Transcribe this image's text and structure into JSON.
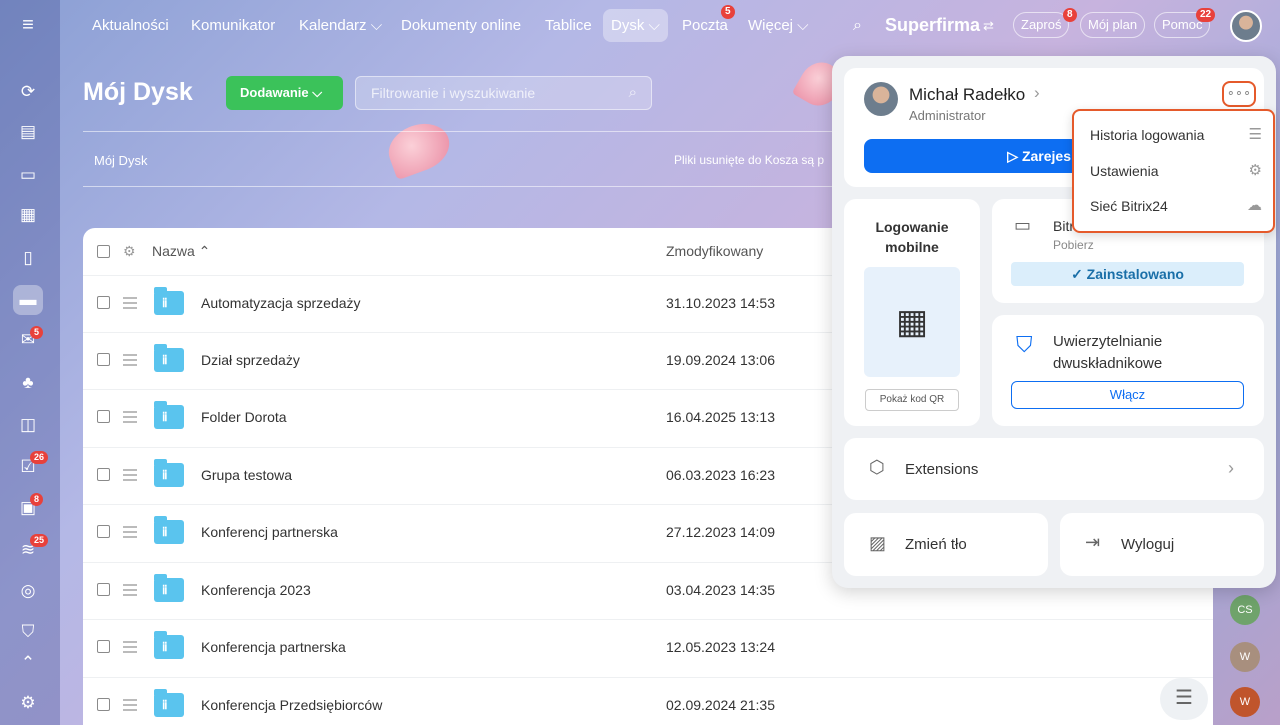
{
  "topnav": {
    "items": [
      "Aktualności",
      "Komunikator",
      "Kalendarz ⌵",
      "Dokumenty online",
      "Tablice",
      "Dysk ⌵",
      "Poczta",
      "Więcej ⌵"
    ],
    "mail_badge": "5",
    "company": "Superfirma",
    "invite": "Zaproś",
    "invite_badge": "8",
    "plan": "Mój plan",
    "help": "Pomoc",
    "help_badge": "22"
  },
  "sidebar": {
    "badges": {
      "mail": "5",
      "tasks": "26",
      "news": "8",
      "crm": "25"
    }
  },
  "page": {
    "title": "Mój Dysk",
    "add_button": "Dodawanie ⌵",
    "search_placeholder": "Filtrowanie i wyszukiwanie",
    "breadcrumb": "Mój Dysk",
    "trash_note": "Pliki usunięte do Kosza są p"
  },
  "table": {
    "col_name": "Nazwa ⌃",
    "col_modified": "Zmodyfikowany",
    "rows": [
      {
        "name": "Automatyzacja sprzedaży",
        "date": "31.10.2023 14:53"
      },
      {
        "name": "Dział sprzedaży",
        "date": "19.09.2024 13:06"
      },
      {
        "name": "Folder Dorota",
        "date": "16.04.2025 13:13"
      },
      {
        "name": "Grupa testowa",
        "date": "06.03.2023 16:23"
      },
      {
        "name": "Konferencj partnerska",
        "date": "27.12.2023 14:09"
      },
      {
        "name": "Konferencja 2023",
        "date": "03.04.2023 14:35"
      },
      {
        "name": "Konferencja partnerska",
        "date": "12.05.2023 13:24"
      },
      {
        "name": "Konferencja Przedsiębiorców",
        "date": "02.09.2024 21:35"
      }
    ]
  },
  "profile": {
    "name": "Michał Radełko",
    "role": "Administrator",
    "register_label": "▷ Zarejes",
    "mobile_login": "Logowanie mobilne",
    "show_qr": "Pokaż kod QR",
    "desktop_app": "Bitr",
    "download": "Pobierz",
    "installed": "✓ Zainstalowano",
    "twofa": "Uwierzytelnianie dwuskładnikowe",
    "enable": "Włącz",
    "extensions": "Extensions",
    "change_bg": "Zmień tło",
    "logout": "Wyloguj"
  },
  "menu": {
    "items": [
      "Historia logowania",
      "Ustawienia",
      "Sieć Bitrix24"
    ]
  },
  "right_avatars": [
    "CS",
    "W",
    "W"
  ],
  "colors": {
    "accent": "#0d6ef2",
    "green": "#3bc25a",
    "badge": "#e8413b",
    "highlight": "#e55a2b"
  }
}
